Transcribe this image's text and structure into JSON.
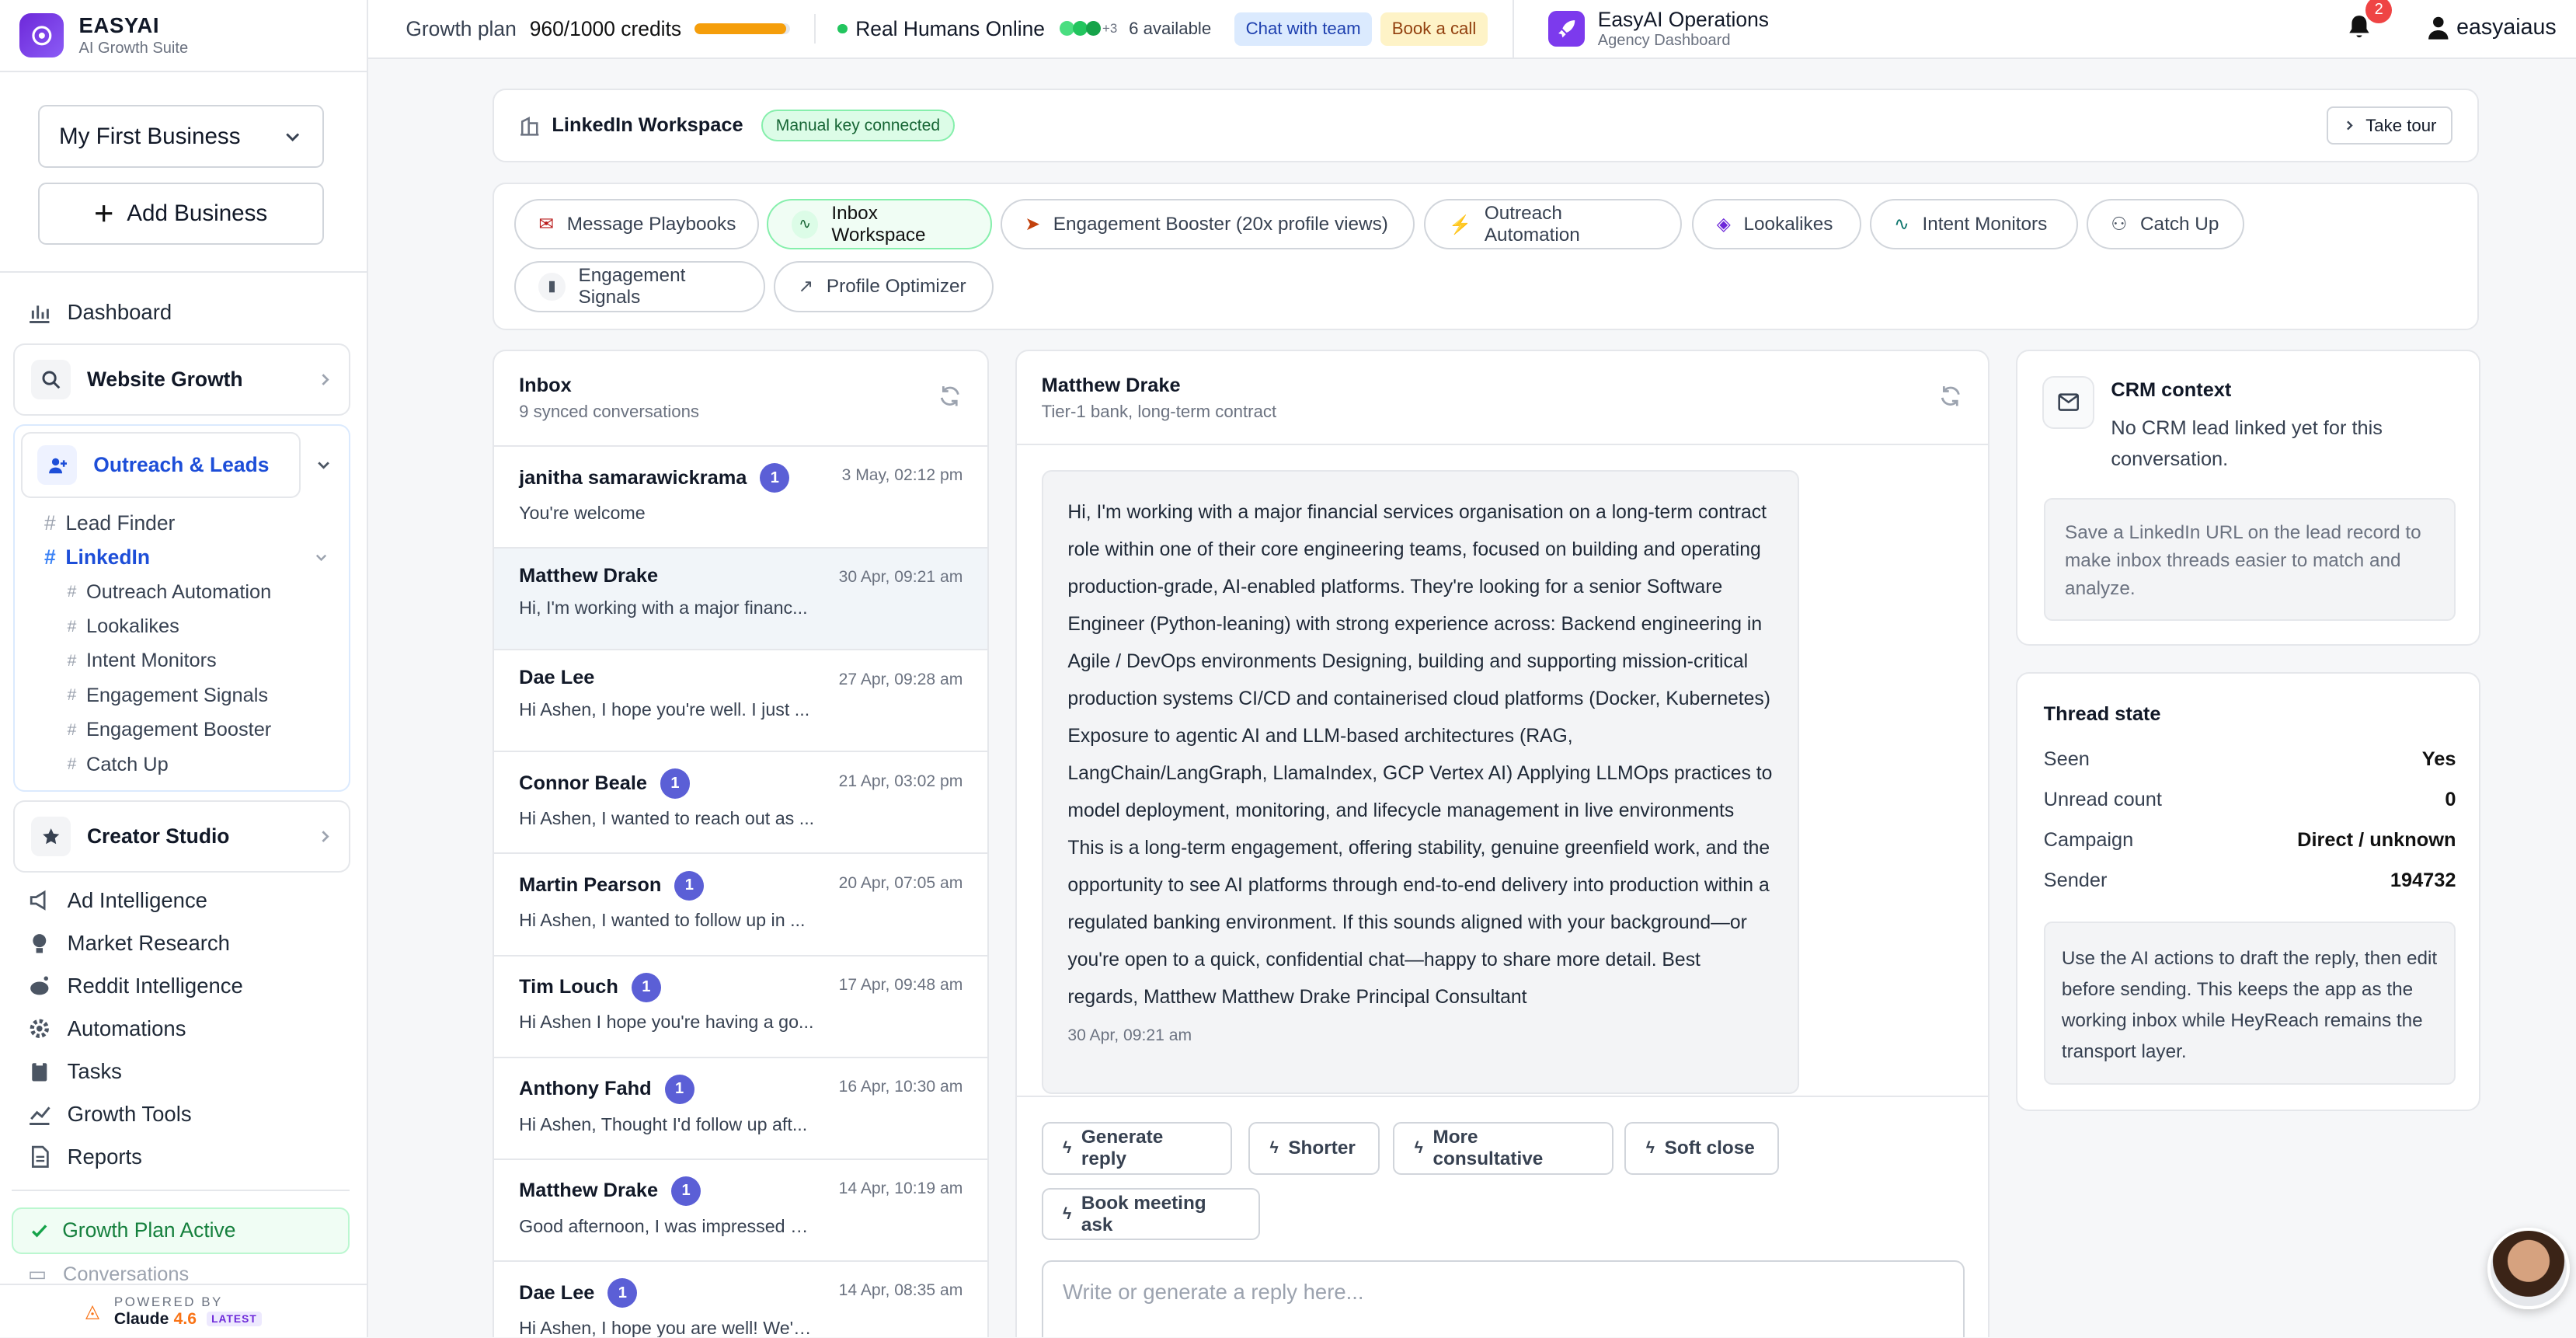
{
  "brand": {
    "title": "EASYAI",
    "subtitle": "AI Growth Suite"
  },
  "business": {
    "selected": "My First Business",
    "add_label": "Add Business"
  },
  "nav": {
    "dashboard": "Dashboard",
    "website_growth": "Website Growth",
    "outreach": "Outreach & Leads",
    "lead_finder": "Lead Finder",
    "linkedin": "LinkedIn",
    "linkedin_sub": [
      "Outreach Automation",
      "Lookalikes",
      "Intent Monitors",
      "Engagement Signals",
      "Engagement Booster",
      "Catch Up"
    ],
    "creator_studio": "Creator Studio",
    "items": [
      "Ad Intelligence",
      "Market Research",
      "Reddit Intelligence",
      "Automations",
      "Tasks",
      "Growth Tools",
      "Reports"
    ],
    "growth_plan": "Growth Plan Active",
    "conversations": "Conversations",
    "powered_by": "POWERED BY",
    "claude": "Claude",
    "claude_version": "4.6",
    "latest": "LATEST"
  },
  "topbar": {
    "plan": "Growth plan",
    "credits": "960/1000 credits",
    "credits_fraction": 0.96,
    "humans": "Real Humans Online",
    "avatar_more": "+3",
    "available": "6 available",
    "chat": "Chat with team",
    "book": "Book a call",
    "ops_title": "EasyAI Operations",
    "ops_sub": "Agency Dashboard",
    "notifications": "2",
    "user": "easyaiaus"
  },
  "workspace": {
    "title": "LinkedIn Workspace",
    "status": "Manual key connected",
    "tour": "Take tour"
  },
  "tabs": [
    "Message Playbooks",
    "Inbox Workspace",
    "Engagement Booster (20x profile views)",
    "Outreach Automation",
    "Lookalikes",
    "Intent Monitors",
    "Catch Up",
    "Engagement Signals",
    "Profile Optimizer"
  ],
  "inbox": {
    "title": "Inbox",
    "subtitle": "9 synced conversations",
    "rows": [
      {
        "name": "janitha samarawickrama",
        "badge": "1",
        "date": "3 May, 02:12 pm",
        "preview": "You're welcome"
      },
      {
        "name": "Matthew Drake",
        "badge": "",
        "date": "30 Apr, 09:21 am",
        "preview": "Hi, I'm working with a major financ..."
      },
      {
        "name": "Dae Lee",
        "badge": "",
        "date": "27 Apr, 09:28 am",
        "preview": "Hi Ashen, I hope you're well. I just ..."
      },
      {
        "name": "Connor Beale",
        "badge": "1",
        "date": "21 Apr, 03:02 pm",
        "preview": "Hi Ashen, I wanted to reach out as ..."
      },
      {
        "name": "Martin Pearson",
        "badge": "1",
        "date": "20 Apr, 07:05 am",
        "preview": "Hi Ashen, I wanted to follow up in ..."
      },
      {
        "name": "Tim Louch",
        "badge": "1",
        "date": "17 Apr, 09:48 am",
        "preview": "Hi Ashen I hope you're having a go..."
      },
      {
        "name": "Anthony Fahd",
        "badge": "1",
        "date": "16 Apr, 10:30 am",
        "preview": "Hi Ashen, Thought I'd follow up aft..."
      },
      {
        "name": "Matthew Drake",
        "badge": "1",
        "date": "14 Apr, 10:19 am",
        "preview": "Good afternoon, I was impressed b..."
      },
      {
        "name": "Dae Lee",
        "badge": "1",
        "date": "14 Apr, 08:35 am",
        "preview": "Hi Ashen, I hope you are well! We're..."
      }
    ]
  },
  "thread": {
    "name": "Matthew Drake",
    "subtitle": "Tier-1 bank, long-term contract",
    "message": "Hi, I'm working with a major financial services organisation on a long-term contract role within one of their core engineering teams, focused on building and operating production-grade, AI-enabled platforms. They're looking for a senior Software Engineer (Python-leaning) with strong experience across: Backend engineering in Agile / DevOps environments Designing, building and supporting mission-critical production systems CI/CD and containerised cloud platforms (Docker, Kubernetes) Exposure to agentic AI and LLM-based architectures (RAG, LangChain/LangGraph, LlamaIndex, GCP Vertex AI) Applying LLMOps practices to model deployment, monitoring, and lifecycle management in live environments This is a long-term engagement, offering stability, genuine greenfield work, and the opportunity to see AI platforms through end-to-end delivery into production within a regulated banking environment. If this sounds aligned with your background—or you're open to a quick, confidential chat—happy to share more detail. Best regards, Matthew Matthew Drake Principal Consultant",
    "time": "30 Apr, 09:21 am",
    "actions": [
      "Generate reply",
      "Shorter",
      "More consultative",
      "Soft close",
      "Book meeting ask"
    ],
    "placeholder": "Write or generate a reply here..."
  },
  "crm": {
    "title": "CRM context",
    "text": "No CRM lead linked yet for this conversation.",
    "hint": "Save a LinkedIn URL on the lead record to make inbox threads easier to match and analyze."
  },
  "state": {
    "title": "Thread state",
    "rows": [
      {
        "k": "Seen",
        "v": "Yes"
      },
      {
        "k": "Unread count",
        "v": "0"
      },
      {
        "k": "Campaign",
        "v": "Direct / unknown"
      },
      {
        "k": "Sender",
        "v": "194732"
      }
    ],
    "note": "Use the AI actions to draft the reply, then edit before sending. This keeps the app as the working inbox while HeyReach remains the transport layer."
  }
}
